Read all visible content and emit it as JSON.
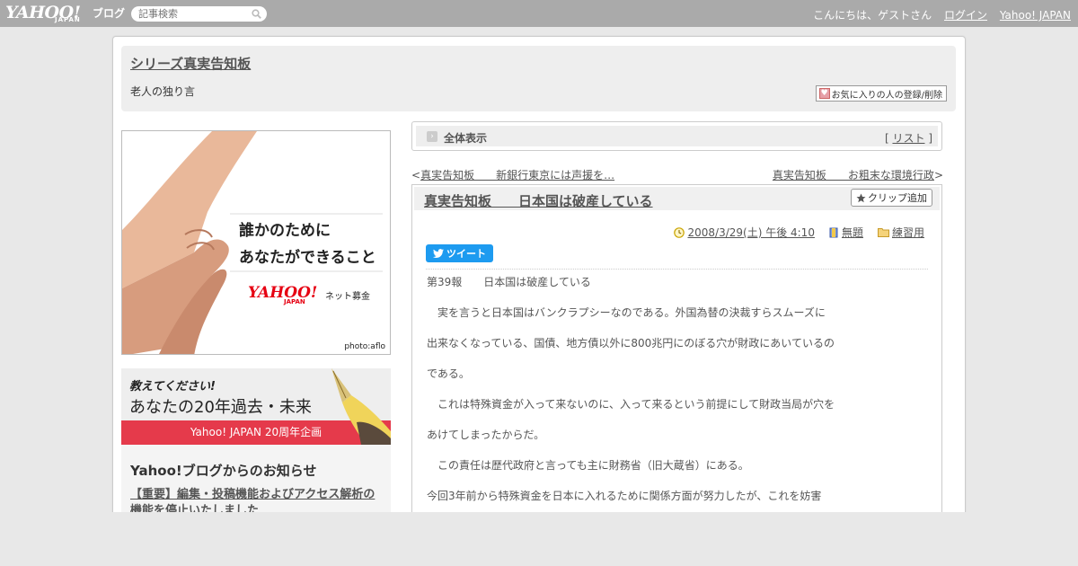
{
  "topbar": {
    "logo_main": "YAHOO!",
    "logo_sub": "JAPAN",
    "logo_service": "ブログ",
    "search_placeholder": "記事検索",
    "greeting": "こんにちは、ゲストさん",
    "login_label": "ログイン",
    "yahoo_japan_label": "Yahoo! JAPAN"
  },
  "blog": {
    "title": "シリーズ真実告知板",
    "subtitle": "老人の独り言",
    "favorite_button": "お気に入りの人の登録/削除"
  },
  "left": {
    "banner1": {
      "line1": "誰かのために",
      "line2": "あなたができること",
      "logo": "YAHOO!",
      "logo_sub": "JAPAN",
      "service": "ネット募金",
      "credit": "photo:aflo"
    },
    "banner2": {
      "question": "教えてください!",
      "main": "あなたの20年過去・未来",
      "bar": "Yahoo! JAPAN 20周年企画"
    },
    "notice": {
      "heading": "Yahoo!ブログからのお知らせ",
      "link": "【重要】編集・投稿機能およびアクセス解析の機能を停止いたしました"
    }
  },
  "viewbar": {
    "label": "全体表示",
    "list_prefix": "[",
    "list_label": "リスト",
    "list_suffix": "]"
  },
  "pager": {
    "prev_arrow": "<",
    "prev_label": "真実告知板　　新銀行東京には声援を…",
    "next_label": "真実告知板　　お粗末な環境行政",
    "next_arrow": ">"
  },
  "article": {
    "title": "真実告知板　　日本国は破産している",
    "clip_button": "クリップ追加",
    "date": "2008/3/29(土) 午後 4:10",
    "theme": "無題",
    "category": "練習用",
    "tweet_label": "ツイート",
    "paragraphs": [
      "第39報　　日本国は破産している",
      "　実を言うと日本国はバンクラプシーなのである。外国為替の決裁すらスムーズに",
      "出来なくなっている、国債、地方債以外に800兆円にのぼる穴が財政にあいているの",
      "である。",
      "　これは特殊資金が入って来ないのに、入って来るという前提にして財政当局が穴を",
      "あけてしまったからだ。",
      "　この責任は歴代政府と言っても主に財務省（旧大蔵省）にある。",
      "今回3年前から特殊資金を日本に入れるために関係方面が努力したが、これを妨害"
    ]
  },
  "colors": {
    "topbar": "#aaaaaa",
    "panel": "#eeeeee",
    "tweet": "#1d9bf0",
    "banner_red": "#e53a4b"
  }
}
